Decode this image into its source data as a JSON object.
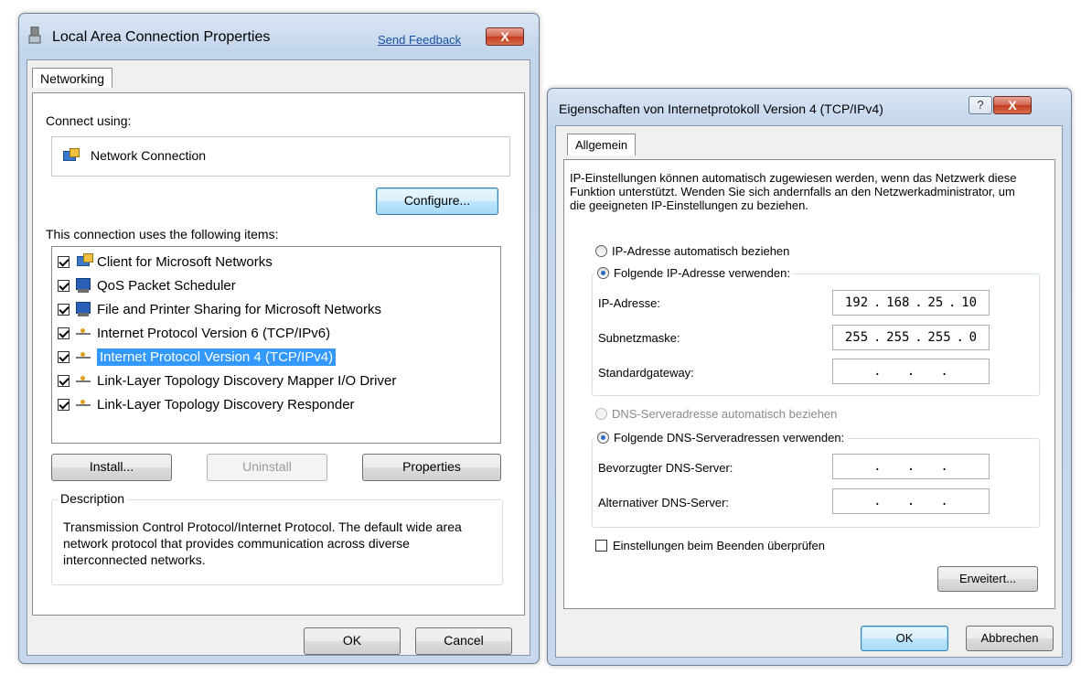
{
  "left_dialog": {
    "title": "Local Area Connection Properties",
    "send_feedback": "Send Feedback",
    "close_label": "X",
    "tab_label": "Networking",
    "connect_using_label": "Connect using:",
    "adapter_name": "Network Connection",
    "configure_button": "Configure...",
    "items_label": "This connection uses the following items:",
    "items": [
      {
        "label": "Client for Microsoft Networks",
        "checked": true,
        "icon": "network-client-icon"
      },
      {
        "label": "QoS Packet Scheduler",
        "checked": true,
        "icon": "service-icon"
      },
      {
        "label": "File and Printer Sharing for Microsoft Networks",
        "checked": true,
        "icon": "service-icon"
      },
      {
        "label": "Internet Protocol Version 6 (TCP/IPv6)",
        "checked": true,
        "icon": "protocol-icon"
      },
      {
        "label": "Internet Protocol Version 4 (TCP/IPv4)",
        "checked": true,
        "icon": "protocol-icon",
        "selected": true
      },
      {
        "label": "Link-Layer Topology Discovery Mapper I/O Driver",
        "checked": true,
        "icon": "protocol-icon"
      },
      {
        "label": "Link-Layer Topology Discovery Responder",
        "checked": true,
        "icon": "protocol-icon"
      }
    ],
    "install_button": "Install...",
    "uninstall_button": "Uninstall",
    "properties_button": "Properties",
    "description_legend": "Description",
    "description_text": "Transmission Control Protocol/Internet Protocol. The default wide area network protocol that provides communication across diverse interconnected networks.",
    "ok_button": "OK",
    "cancel_button": "Cancel"
  },
  "right_dialog": {
    "title": "Eigenschaften von Internetprotokoll Version 4 (TCP/IPv4)",
    "help_label": "?",
    "close_label": "X",
    "tab_label": "Allgemein",
    "intro_text": "IP-Einstellungen können automatisch zugewiesen werden, wenn das Netzwerk diese Funktion unterstützt. Wenden Sie sich andernfalls an den Netzwerkadministrator, um die geeigneten IP-Einstellungen zu beziehen.",
    "radio_auto_ip": "IP-Adresse automatisch beziehen",
    "radio_manual_ip": "Folgende IP-Adresse verwenden:",
    "ip_label": "IP-Adresse:",
    "ip_value": [
      "192",
      "168",
      "25",
      "10"
    ],
    "subnet_label": "Subnetzmaske:",
    "subnet_value": [
      "255",
      "255",
      "255",
      "0"
    ],
    "gateway_label": "Standardgateway:",
    "radio_auto_dns": "DNS-Serveradresse automatisch beziehen",
    "radio_manual_dns": "Folgende DNS-Serveradressen verwenden:",
    "dns_pref_label": "Bevorzugter DNS-Server:",
    "dns_alt_label": "Alternativer DNS-Server:",
    "validate_checkbox": "Einstellungen beim Beenden überprüfen",
    "advanced_button": "Erweitert...",
    "ok_button": "OK",
    "cancel_button": "Abbrechen",
    "dot": "."
  }
}
